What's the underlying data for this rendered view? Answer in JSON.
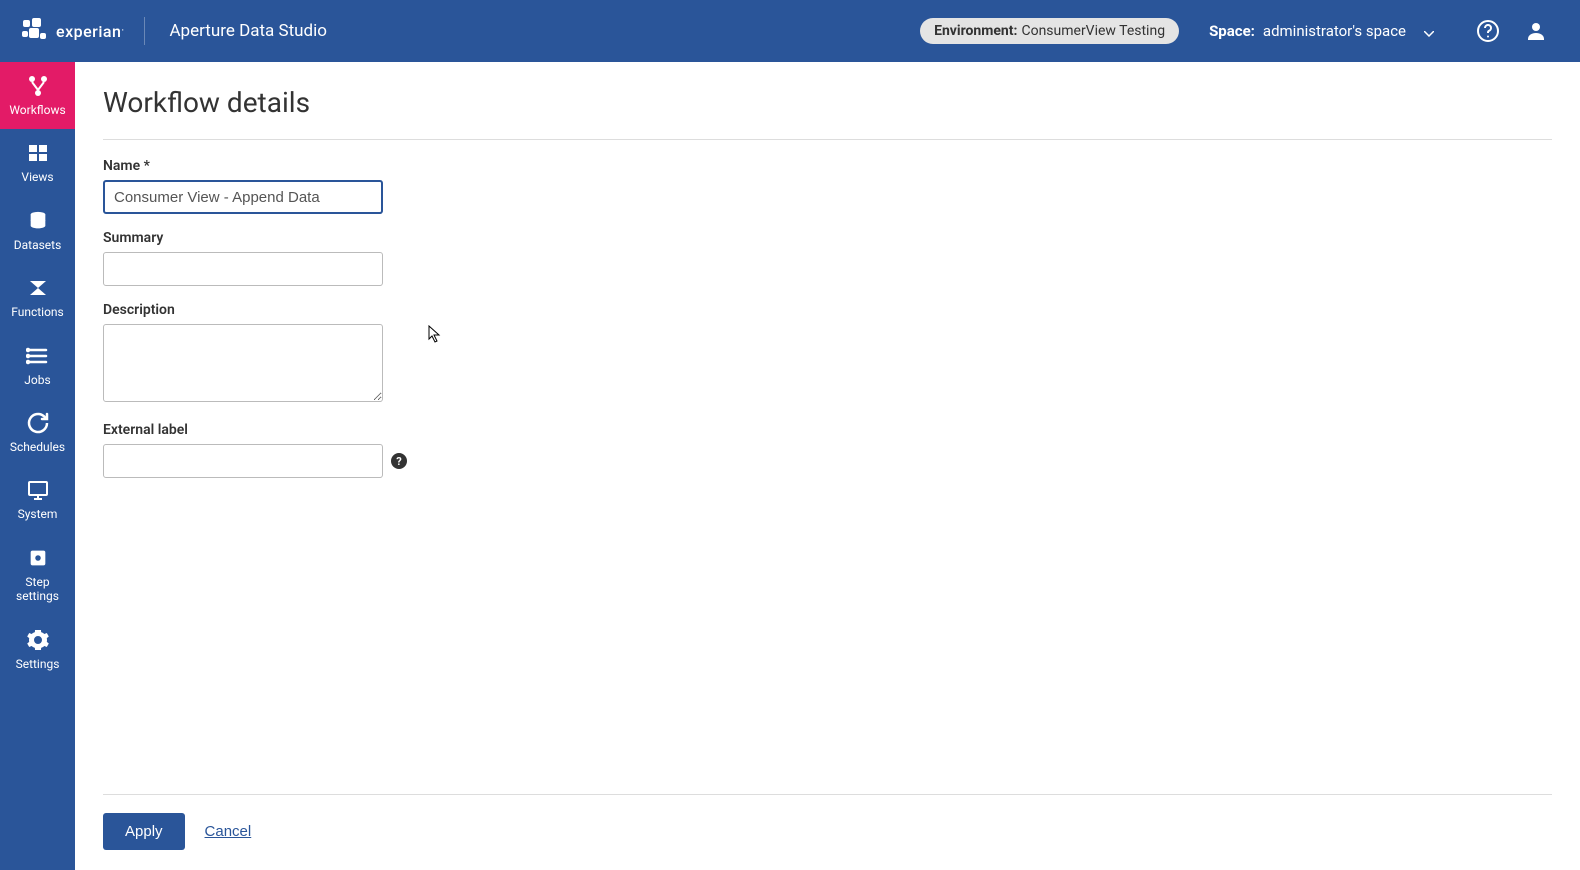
{
  "header": {
    "logo_text": "experian",
    "app_name": "Aperture Data Studio",
    "env_label": "Environment:",
    "env_value": "ConsumerView Testing",
    "space_label": "Space:",
    "space_value": "administrator's space"
  },
  "sidebar": {
    "items": [
      {
        "id": "workflows",
        "label": "Workflows",
        "active": true
      },
      {
        "id": "views",
        "label": "Views",
        "active": false
      },
      {
        "id": "datasets",
        "label": "Datasets",
        "active": false
      },
      {
        "id": "functions",
        "label": "Functions",
        "active": false
      },
      {
        "id": "jobs",
        "label": "Jobs",
        "active": false
      },
      {
        "id": "schedules",
        "label": "Schedules",
        "active": false
      },
      {
        "id": "system",
        "label": "System",
        "active": false
      },
      {
        "id": "step-settings",
        "label": "Step settings",
        "active": false
      },
      {
        "id": "settings",
        "label": "Settings",
        "active": false
      }
    ]
  },
  "page": {
    "title": "Workflow details"
  },
  "form": {
    "name_label": "Name *",
    "name_value": "Consumer View - Append Data",
    "summary_label": "Summary",
    "summary_value": "",
    "description_label": "Description",
    "description_value": "",
    "external_label": "External label",
    "external_value": ""
  },
  "footer": {
    "apply_label": "Apply",
    "cancel_label": "Cancel"
  }
}
